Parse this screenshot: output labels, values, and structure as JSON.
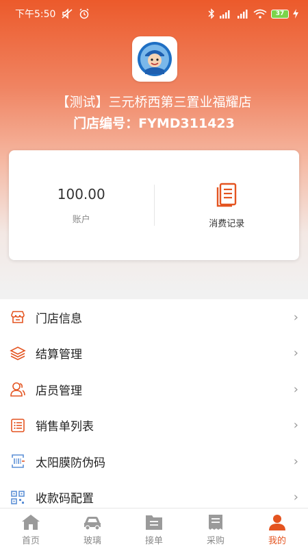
{
  "status_bar": {
    "time": "下午5:50",
    "battery": "37"
  },
  "store": {
    "name": "【测试】三元桥西第三置业福耀店",
    "code_label": "门店编号：",
    "code": "FYMD311423"
  },
  "account_card": {
    "balance": "100.00",
    "balance_label": "账户",
    "records_label": "消费记录"
  },
  "menu": [
    {
      "label": "门店信息",
      "icon": "store-icon"
    },
    {
      "label": "结算管理",
      "icon": "layers-icon"
    },
    {
      "label": "店员管理",
      "icon": "people-icon"
    },
    {
      "label": "销售单列表",
      "icon": "list-icon"
    },
    {
      "label": "太阳膜防伪码",
      "icon": "barcode-icon"
    },
    {
      "label": "收款码配置",
      "icon": "qrcode-icon"
    }
  ],
  "tabs": [
    {
      "label": "首页",
      "icon": "home-icon"
    },
    {
      "label": "玻璃",
      "icon": "car-icon"
    },
    {
      "label": "接单",
      "icon": "folder-icon"
    },
    {
      "label": "采购",
      "icon": "receipt-icon"
    },
    {
      "label": "我的",
      "icon": "user-icon",
      "active": true
    }
  ],
  "colors": {
    "accent": "#e45420",
    "header_top": "#ec5a2b"
  }
}
